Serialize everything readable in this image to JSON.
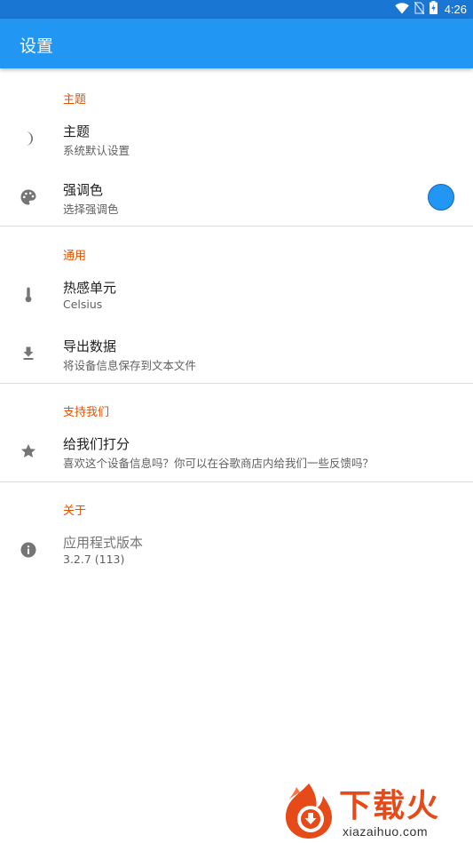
{
  "status_bar": {
    "time": "4:26",
    "icons": [
      "wifi-icon",
      "no-sim-icon",
      "battery-charging-icon"
    ]
  },
  "app_bar": {
    "title": "设置",
    "color": "#2196f3"
  },
  "sections": [
    {
      "header": "主题",
      "items": [
        {
          "icon": "moon-icon",
          "title": "主题",
          "summary": "系统默认设置"
        },
        {
          "icon": "palette-icon",
          "title": "强调色",
          "summary": "选择强调色",
          "accent_color": "#2196f3"
        }
      ]
    },
    {
      "header": "通用",
      "items": [
        {
          "icon": "thermometer-icon",
          "title": "热感单元",
          "summary": "Celsius"
        },
        {
          "icon": "download-icon",
          "title": "导出数据",
          "summary": "将设备信息保存到文本文件"
        }
      ]
    },
    {
      "header": "支持我们",
      "items": [
        {
          "icon": "star-icon",
          "title": "给我们打分",
          "summary": "喜欢这个设备信息吗？你可以在谷歌商店内给我们一些反馈吗？"
        }
      ]
    },
    {
      "header": "关于",
      "items": [
        {
          "icon": "info-icon",
          "title": "应用程式版本",
          "summary": "3.2.7 (113)"
        }
      ]
    }
  ],
  "watermark": {
    "text": "下载火",
    "url": "xiazaihuo.com",
    "color": "#e64a19"
  },
  "section_header_color": "#e65100"
}
